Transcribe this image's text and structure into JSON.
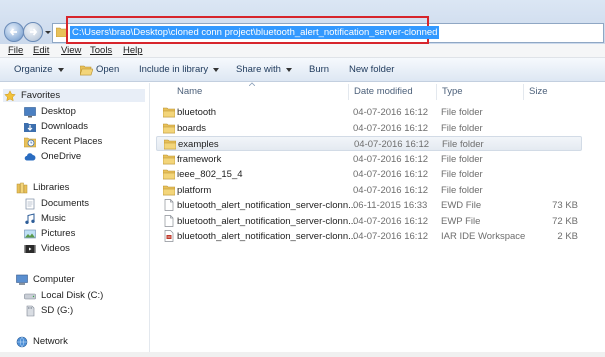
{
  "address": {
    "path": "C:\\Users\\brao\\Desktop\\cloned conn project\\bluetooth_alert_notification_server-clonned"
  },
  "menu": [
    "File",
    "Edit",
    "View",
    "Tools",
    "Help"
  ],
  "toolbar": {
    "organize": "Organize",
    "open": "Open",
    "include_in_library": "Include in library",
    "share_with": "Share with",
    "burn": "Burn",
    "new_folder": "New folder"
  },
  "sidebar": {
    "favorites": {
      "label": "Favorites",
      "items": [
        "Desktop",
        "Downloads",
        "Recent Places",
        "OneDrive"
      ]
    },
    "libraries": {
      "label": "Libraries",
      "items": [
        "Documents",
        "Music",
        "Pictures",
        "Videos"
      ]
    },
    "computer": {
      "label": "Computer",
      "items": [
        "Local Disk (C:)",
        "SD (G:)"
      ]
    },
    "network": {
      "label": "Network"
    }
  },
  "columns": {
    "name": "Name",
    "date_modified": "Date modified",
    "type": "Type",
    "size": "Size"
  },
  "files": [
    {
      "name": "bluetooth",
      "date": "04-07-2016 16:12",
      "type": "File folder",
      "size": "",
      "icon": "folder-icon"
    },
    {
      "name": "boards",
      "date": "04-07-2016 16:12",
      "type": "File folder",
      "size": "",
      "icon": "folder-icon"
    },
    {
      "name": "examples",
      "date": "04-07-2016 16:12",
      "type": "File folder",
      "size": "",
      "icon": "folder-icon",
      "selected": true
    },
    {
      "name": "framework",
      "date": "04-07-2016 16:12",
      "type": "File folder",
      "size": "",
      "icon": "folder-icon"
    },
    {
      "name": "ieee_802_15_4",
      "date": "04-07-2016 16:12",
      "type": "File folder",
      "size": "",
      "icon": "folder-icon"
    },
    {
      "name": "platform",
      "date": "04-07-2016 16:12",
      "type": "File folder",
      "size": "",
      "icon": "folder-icon"
    },
    {
      "name": "bluetooth_alert_notification_server-clonn...",
      "date": "06-11-2015 16:33",
      "type": "EWD File",
      "size": "73 KB",
      "icon": "file-icon"
    },
    {
      "name": "bluetooth_alert_notification_server-clonn...",
      "date": "04-07-2016 16:12",
      "type": "EWP File",
      "size": "72 KB",
      "icon": "file-icon"
    },
    {
      "name": "bluetooth_alert_notification_server-clonn...",
      "date": "04-07-2016 16:12",
      "type": "IAR IDE Workspace",
      "size": "2 KB",
      "icon": "workspace-icon"
    }
  ],
  "colors": {
    "highlight_box": "#d7252c",
    "address_selection": "#3399ff",
    "folder": "#e8c15a"
  }
}
